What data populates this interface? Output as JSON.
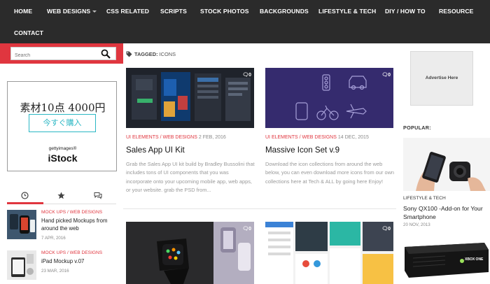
{
  "nav": {
    "items": [
      {
        "label": "HOME"
      },
      {
        "label": "WEB DESIGNS"
      },
      {
        "label": "CSS RELATED"
      },
      {
        "label": "SCRIPTS"
      },
      {
        "label": "STOCK PHOTOS"
      },
      {
        "label": "BACKGROUNDS"
      },
      {
        "label": "LIFESTYLE & TECH"
      },
      {
        "label": "DIY / HOW TO"
      },
      {
        "label": "RESOURCE"
      },
      {
        "label": "CONTACT"
      }
    ]
  },
  "search": {
    "placeholder": "Search"
  },
  "ad_left": {
    "headline": "素材10点 4000円",
    "button": "今すぐ購入",
    "brand_small": "gettyimages®",
    "brand_big": "iStock"
  },
  "tagged": {
    "prefix": "TAGGED:",
    "tag": "ICONS"
  },
  "cards": [
    {
      "comments": "0",
      "category": "UI ELEMENTS / WEB DESIGNS",
      "date": "2 FEB, 2016",
      "title": "Sales App UI Kit",
      "excerpt": "Grab the Sales App UI kit build by Bradley Bussolini that includes tons of UI components that you was incorporate onto your upcoming mobile app, web apps, or your website. grab the PSD from..."
    },
    {
      "comments": "0",
      "category": "UI ELEMENTS / WEB DESIGNS",
      "date": "14 DEC, 2015",
      "title": "Massive Icon Set v.9",
      "excerpt": "Download the icon collections from around the web below, you can even download more icons from our own collections here at Tech & ALL by going here Enjoy!"
    },
    {
      "comments": "0"
    },
    {
      "comments": "0"
    }
  ],
  "side_posts": [
    {
      "category": "MOCK UPS / WEB DESIGNS",
      "title": "Hand picked Mockups from around the web",
      "date": "7 APR, 2016"
    },
    {
      "category": "MOCK UPS / WEB DESIGNS",
      "title": "iPad Mockup v.07",
      "date": "23 MAR, 2016"
    }
  ],
  "ad_right": {
    "label": "Advertise Here"
  },
  "popular": {
    "label": "POPULAR:",
    "category": "LIFESTYLE & TECH",
    "title": "Sony QX100 -Add-on for Your Smartphone",
    "date": "20 NOV, 2013",
    "box_label": "XBOX ONE"
  },
  "colors": {
    "nav_bg": "#2b2b2b",
    "accent": "#e0363f",
    "teal": "#2bb7c4"
  }
}
